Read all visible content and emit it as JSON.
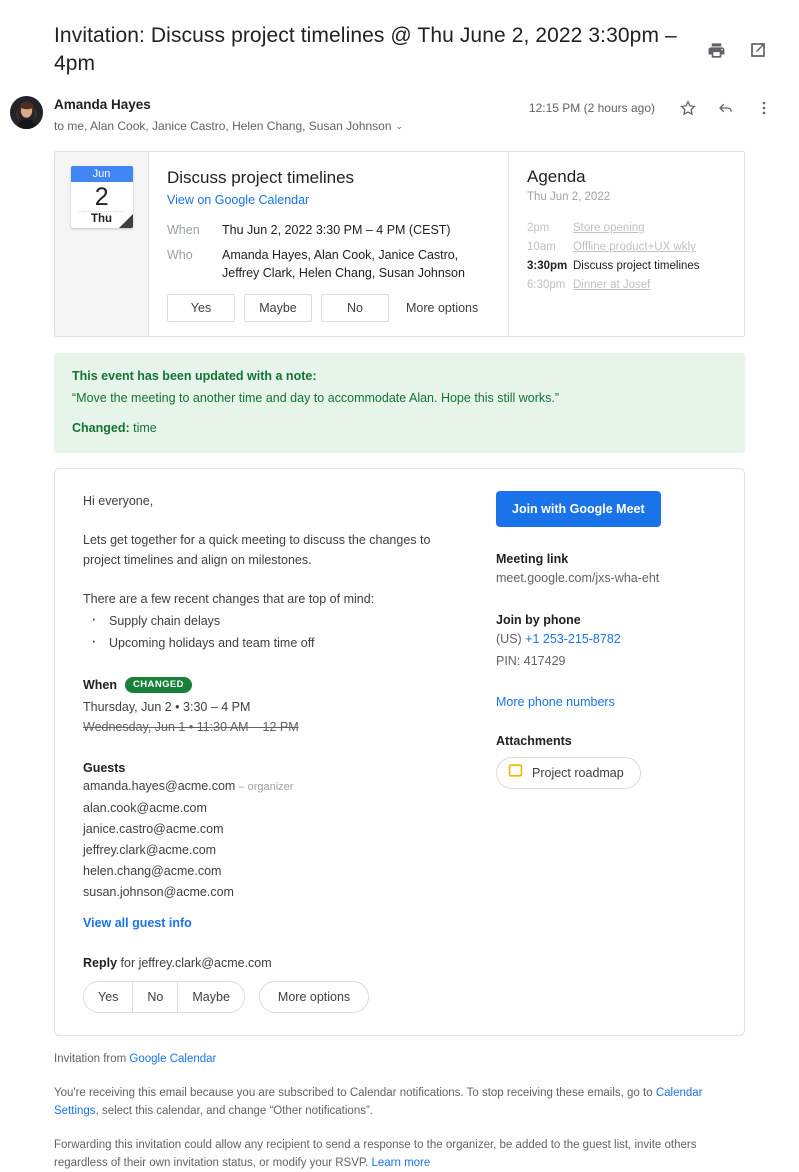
{
  "header": {
    "subject": "Invitation: Discuss project timelines @ Thu June 2, 2022 3:30pm – 4pm",
    "print_icon": "print-icon",
    "open_new_icon": "open-in-new-icon"
  },
  "sender": {
    "name": "Amanda Hayes",
    "recipients": "to me, Alan Cook, Janice Castro, Helen Chang, Susan Johnson",
    "caret": "⌄",
    "timestamp": "12:15 PM (2 hours ago)",
    "star_icon": "star-icon",
    "reply_icon": "reply-icon",
    "more_icon": "more-vert-icon"
  },
  "event": {
    "calendar": {
      "month": "Jun",
      "day": "2",
      "weekday": "Thu"
    },
    "title": "Discuss project timelines",
    "view_link": "View on Google Calendar",
    "rows": [
      {
        "label": "When",
        "value": "Thu Jun 2, 2022 3:30 PM – 4 PM (CEST)"
      },
      {
        "label": "Who",
        "value": "Amanda Hayes, Alan Cook, Janice Castro, Jeffrey Clark, Helen Chang, Susan Johnson"
      }
    ],
    "rsvp": [
      "Yes",
      "Maybe",
      "No"
    ],
    "more_options": "More options"
  },
  "agenda": {
    "title": "Agenda",
    "subtitle": "Thu Jun 2, 2022",
    "items": [
      {
        "time": "2pm",
        "name": "Store opening",
        "current": false
      },
      {
        "time": "10am",
        "name": "Offline product+UX wkly",
        "current": false
      },
      {
        "time": "3:30pm",
        "name": "Discuss project timelines",
        "current": true
      },
      {
        "time": "6:30pm",
        "name": "Dinner at Josef",
        "current": false
      }
    ]
  },
  "banner": {
    "title": "This event has been updated with a note:",
    "note": "“Move the meeting to another time and day to accommodate Alan. Hope this still works.”",
    "changed_label": "Changed:",
    "changed_value": " time",
    "bg_color": "#e6f4ea",
    "text_color": "#137333"
  },
  "body": {
    "greeting": "Hi everyone,",
    "paragraph1": "Lets get together for a quick meeting to discuss the changes to project timelines and align on milestones.",
    "paragraph2": "There are a few recent changes that are top of mind:",
    "bullets": [
      "Supply chain delays",
      "Upcoming holidays and team time off"
    ],
    "when_label": "When",
    "changed_badge": "CHANGED",
    "when_new": "Thursday, Jun 2 • 3:30 – 4 PM",
    "when_old": "Wednesday, Jun 1 • 11:30 AM – 12 PM",
    "guests_label": "Guests",
    "guests": [
      {
        "email": "amanda.hayes@acme.com",
        "role": " – organizer"
      },
      {
        "email": "alan.cook@acme.com",
        "role": ""
      },
      {
        "email": "janice.castro@acme.com",
        "role": ""
      },
      {
        "email": "jeffrey.clark@acme.com",
        "role": ""
      },
      {
        "email": "helen.chang@acme.com",
        "role": ""
      },
      {
        "email": "susan.johnson@acme.com",
        "role": ""
      }
    ],
    "view_all_guests": "View all guest info",
    "reply_label": "Reply",
    "reply_for": " for jeffrey.clark@acme.com",
    "rsvp": [
      "Yes",
      "No",
      "Maybe"
    ],
    "more_options": "More options"
  },
  "meet": {
    "join_button": "Join with Google Meet",
    "meeting_link_label": "Meeting link",
    "meeting_link": "meet.google.com/jxs-wha-eht",
    "join_phone_label": "Join by phone",
    "phone_country": "(US) ",
    "phone_number": "+1 253-215-8782",
    "pin": "PIN: 417429",
    "more_numbers": "More phone numbers",
    "attachments_label": "Attachments",
    "attachment_name": "Project roadmap",
    "attachment_icon": "slides-file-icon",
    "button_color": "#1a73e8"
  },
  "footer": {
    "invitation_from": "Invitation from ",
    "invitation_link": "Google Calendar",
    "notice_part1": "You're receiving this email because you are subscribed to Calendar notifications. To stop receiving these emails, go to ",
    "notice_link": "Calendar Settings",
    "notice_part2": ", select this calendar, and change “Other notifications”.",
    "forward_part1": "Forwarding this invitation could allow any recipient to send a response to the organizer, be added to the guest list, invite others regardless of their own invitation status, or modify your RSVP. ",
    "forward_link": "Learn more"
  }
}
